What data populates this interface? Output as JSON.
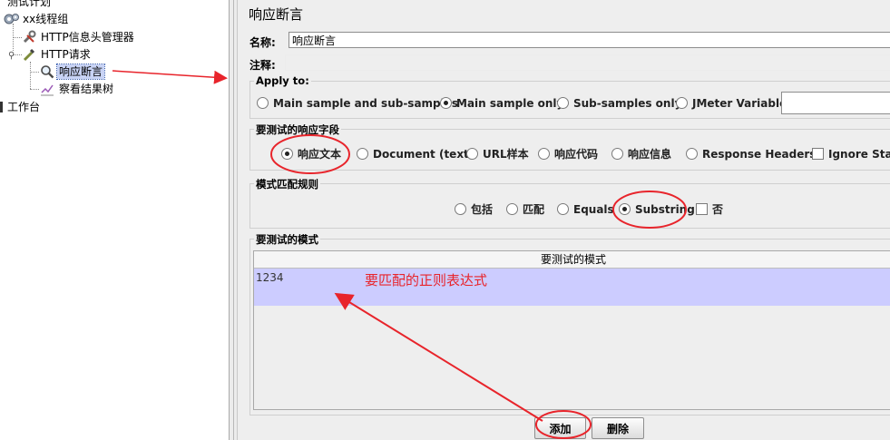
{
  "tree": {
    "test_plan": "测试计划",
    "thread_group": "xx线程组",
    "header_manager": "HTTP信息头管理器",
    "http_request": "HTTP请求",
    "response_assertion": "响应断言",
    "results_tree": "察看结果树",
    "workbench": "工作台"
  },
  "panel": {
    "title": "响应断言",
    "name_label": "名称:",
    "name_value": "响应断言",
    "comment_label": "注释:",
    "comment_value": ""
  },
  "apply_to": {
    "title": "Apply to:",
    "options": [
      "Main sample and sub-samples",
      "Main sample only",
      "Sub-samples only",
      "JMeter Variable"
    ],
    "selected": "Main sample only",
    "variable_value": ""
  },
  "response_field": {
    "title": "要测试的响应字段",
    "options": [
      "响应文本",
      "Document (text)",
      "URL样本",
      "响应代码",
      "响应信息",
      "Response Headers"
    ],
    "selected": "响应文本",
    "ignore_status_label": "Ignore Status",
    "ignore_status": false
  },
  "pattern_rules": {
    "title": "模式匹配规则",
    "options": [
      "包括",
      "匹配",
      "Equals",
      "Substring"
    ],
    "selected": "Substring",
    "not_label": "否",
    "not_checked": false
  },
  "patterns": {
    "title": "要测试的模式",
    "column_header": "要测试的模式",
    "rows": [
      "1234"
    ]
  },
  "buttons": {
    "add": "添加",
    "delete": "删除"
  },
  "annotations": {
    "regex_note": "要匹配的正则表达式"
  },
  "colors": {
    "annotation": "#e8242b",
    "selected_row": "#ccccff"
  }
}
